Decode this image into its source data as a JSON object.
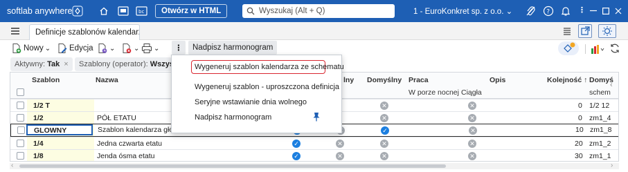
{
  "titlebar": {
    "brand": "softlab anywhere",
    "open_html_label": "Otwórz w HTML",
    "search_placeholder": "Wyszukaj (Alt + Q)",
    "company": "1 - EuroKonkret sp. z o.o.",
    "icons": [
      "apps-icon",
      "home-icon",
      "window-icon",
      "window-bc-icon",
      "attach-icon",
      "help-icon",
      "bell-icon",
      "more-icon",
      "minimize-icon",
      "maximize-icon",
      "close-icon"
    ],
    "bg_color": "#1e5fb4"
  },
  "tab": {
    "label": "Definicje szablonów kalendarzy"
  },
  "toolbar": {
    "new_label": "Nowy",
    "edit_label": "Edycja",
    "overwrite_label": "Nadpisz harmonogram"
  },
  "filters": {
    "active_label": "Aktywny:",
    "active_value": "Tak",
    "operator_label": "Szablony (operator):",
    "operator_value": "Wszystkie"
  },
  "grid": {
    "headers": {
      "szablon": "Szablon",
      "nazwa": "Nazwa",
      "staly": "lny",
      "domyslny": "Domyślny",
      "praca": "Praca",
      "w_porze_nocnej": "W porze nocnej",
      "ciagla": "Ciągła",
      "opis": "Opis",
      "kolejnosc": "Kolejność ↑",
      "domysl_sched_top": "Domyś",
      "domysl_sched_bottom": "schem"
    },
    "rows": [
      {
        "szablon": "1/2 T",
        "nazwa": "",
        "kolejnosc": "0",
        "schemat": "1/2 12"
      },
      {
        "szablon": "1/2",
        "nazwa": "PÓŁ ETATU",
        "kolejnosc": "0",
        "schemat": "zm1_4"
      },
      {
        "szablon": "GLOWNY",
        "nazwa": "Szablon kalendarza główny",
        "kolejnosc": "10",
        "schemat": "zm1_8"
      },
      {
        "szablon": "1/4",
        "nazwa": "Jedna czwarta etatu",
        "kolejnosc": "20",
        "schemat": "zm1_2"
      },
      {
        "szablon": "1/8",
        "nazwa": "Jenda ósma etatu",
        "kolejnosc": "30",
        "schemat": "zm1_1"
      }
    ]
  },
  "menu": {
    "item1": "Wygeneruj szablon kalendarza ze schematu",
    "item2": "Wygeneruj szablon - uproszczona definicja",
    "item3": "Seryjne wstawianie dnia wolnego",
    "item4": "Nadpisz harmonogram"
  },
  "colors": {
    "accent": "#1e5fb4",
    "ok_icon": "#1c7fe0",
    "highlight_border": "#d9262f",
    "filter_col_bg": "#fdfde2"
  }
}
